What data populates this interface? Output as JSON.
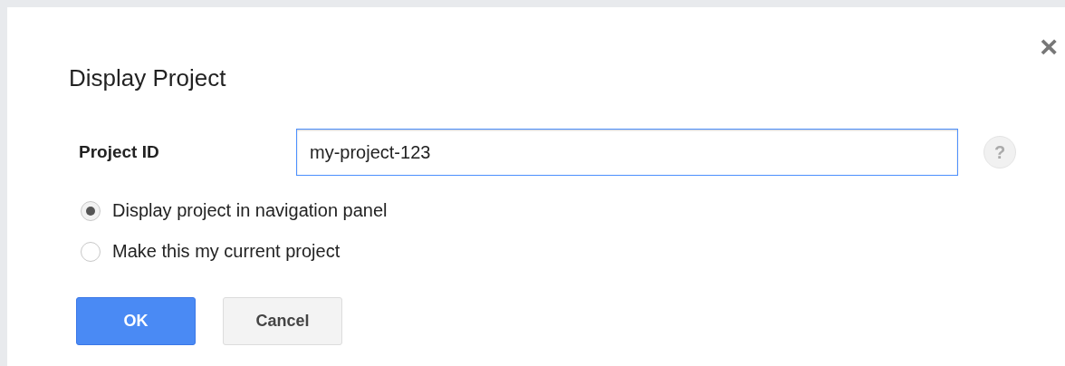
{
  "dialog": {
    "title": "Display Project",
    "close": "×"
  },
  "field": {
    "label": "Project ID",
    "value": "my-project-123",
    "help": "?"
  },
  "options": [
    {
      "label": "Display project in navigation panel",
      "selected": true
    },
    {
      "label": "Make this my current project",
      "selected": false
    }
  ],
  "buttons": [
    {
      "label": "OK",
      "kind": "primary"
    },
    {
      "label": "Cancel",
      "kind": "secondary"
    }
  ]
}
